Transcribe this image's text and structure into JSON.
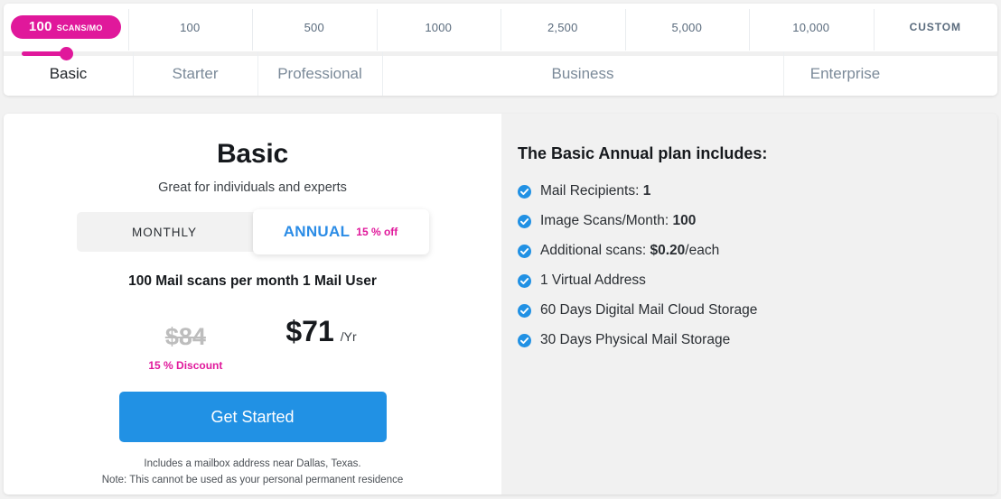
{
  "selector": {
    "scan_tiers": [
      {
        "label": "100 SCANS/MO",
        "badge": true,
        "badge_num": "100",
        "badge_unit": "SCANS/MO"
      },
      {
        "label": "100"
      },
      {
        "label": "500"
      },
      {
        "label": "1000"
      },
      {
        "label": "2,500"
      },
      {
        "label": "5,000"
      },
      {
        "label": "10,000"
      },
      {
        "label": "CUSTOM"
      }
    ],
    "plans": [
      {
        "label": "Basic",
        "active": true,
        "span": 1
      },
      {
        "label": "Starter",
        "active": false,
        "span": 1
      },
      {
        "label": "Professional",
        "active": false,
        "span": 1
      },
      {
        "label": "Business",
        "active": false,
        "span": 3
      },
      {
        "label": "Enterprise",
        "active": false,
        "span": 1
      }
    ],
    "slider_value": "100"
  },
  "plan_card": {
    "title": "Basic",
    "subtitle": "Great for individuals and experts",
    "billing": {
      "monthly_label": "MONTHLY",
      "annual_label": "ANNUAL",
      "annual_discount_label": "15 % off",
      "selected": "ANNUAL"
    },
    "scan_summary": "100 Mail scans per month 1 Mail User",
    "old_price": "$84",
    "discount_label": "15 % Discount",
    "new_price": "$71",
    "price_period": "/Yr",
    "cta_label": "Get Started",
    "note_line_1": "Includes a mailbox address near Dallas, Texas.",
    "note_line_2": "Note: This cannot be used as your personal permanent residence"
  },
  "features": {
    "title": "The Basic Annual plan includes:",
    "items": [
      {
        "text": "Mail Recipients: ",
        "bold": "1"
      },
      {
        "text": "Image Scans/Month: ",
        "bold": "100"
      },
      {
        "text": "Additional scans: ",
        "bold": "$0.20",
        "tail": "/each"
      },
      {
        "text": "1 Virtual Address",
        "bold": ""
      },
      {
        "text": "60 Days Digital Mail Cloud Storage",
        "bold": ""
      },
      {
        "text": "30 Days Physical Mail Storage",
        "bold": ""
      }
    ]
  },
  "colors": {
    "accent_magenta": "#e0189b",
    "accent_blue": "#2191e4",
    "page_bg": "#f2f2f2",
    "panel_bg": "#f1f1f1"
  }
}
